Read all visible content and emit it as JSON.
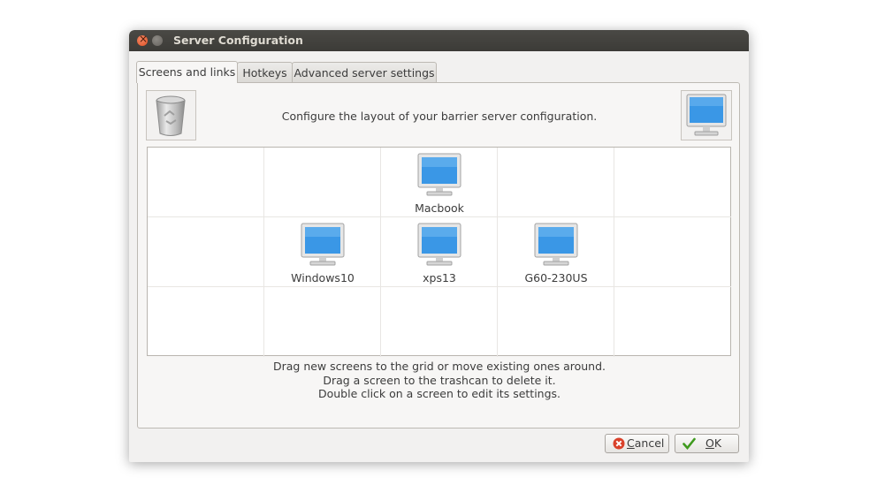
{
  "window": {
    "title": "Server Configuration"
  },
  "tabs": [
    {
      "label": "Screens and links",
      "active": true
    },
    {
      "label": "Hotkeys",
      "active": false
    },
    {
      "label": "Advanced server settings",
      "active": false
    }
  ],
  "panel": {
    "description": "Configure the layout of your barrier server configuration.",
    "trash_icon": "trashcan-icon",
    "new_screen_icon": "monitor-icon"
  },
  "grid": {
    "rows": 3,
    "cols": 5,
    "screens": [
      {
        "name": "Macbook",
        "row": 0,
        "col": 2
      },
      {
        "name": "Windows10",
        "row": 1,
        "col": 1
      },
      {
        "name": "xps13",
        "row": 1,
        "col": 2
      },
      {
        "name": "G60-230US",
        "row": 1,
        "col": 3
      }
    ]
  },
  "help": {
    "line1": "Drag new screens to the grid or move existing ones around.",
    "line2": "Drag a screen to the trashcan to delete it.",
    "line3": "Double click on a screen to edit its settings."
  },
  "buttons": {
    "cancel": {
      "mnemonic": "C",
      "rest": "ancel",
      "icon": "cancel-icon"
    },
    "ok": {
      "mnemonic": "O",
      "rest": "K",
      "icon": "checkmark-icon"
    }
  },
  "colors": {
    "titlebar": "#3c3b37",
    "window_bg": "#f2f1f0",
    "screen_blue": "#2f8fe0",
    "close_orange": "#e05024"
  }
}
